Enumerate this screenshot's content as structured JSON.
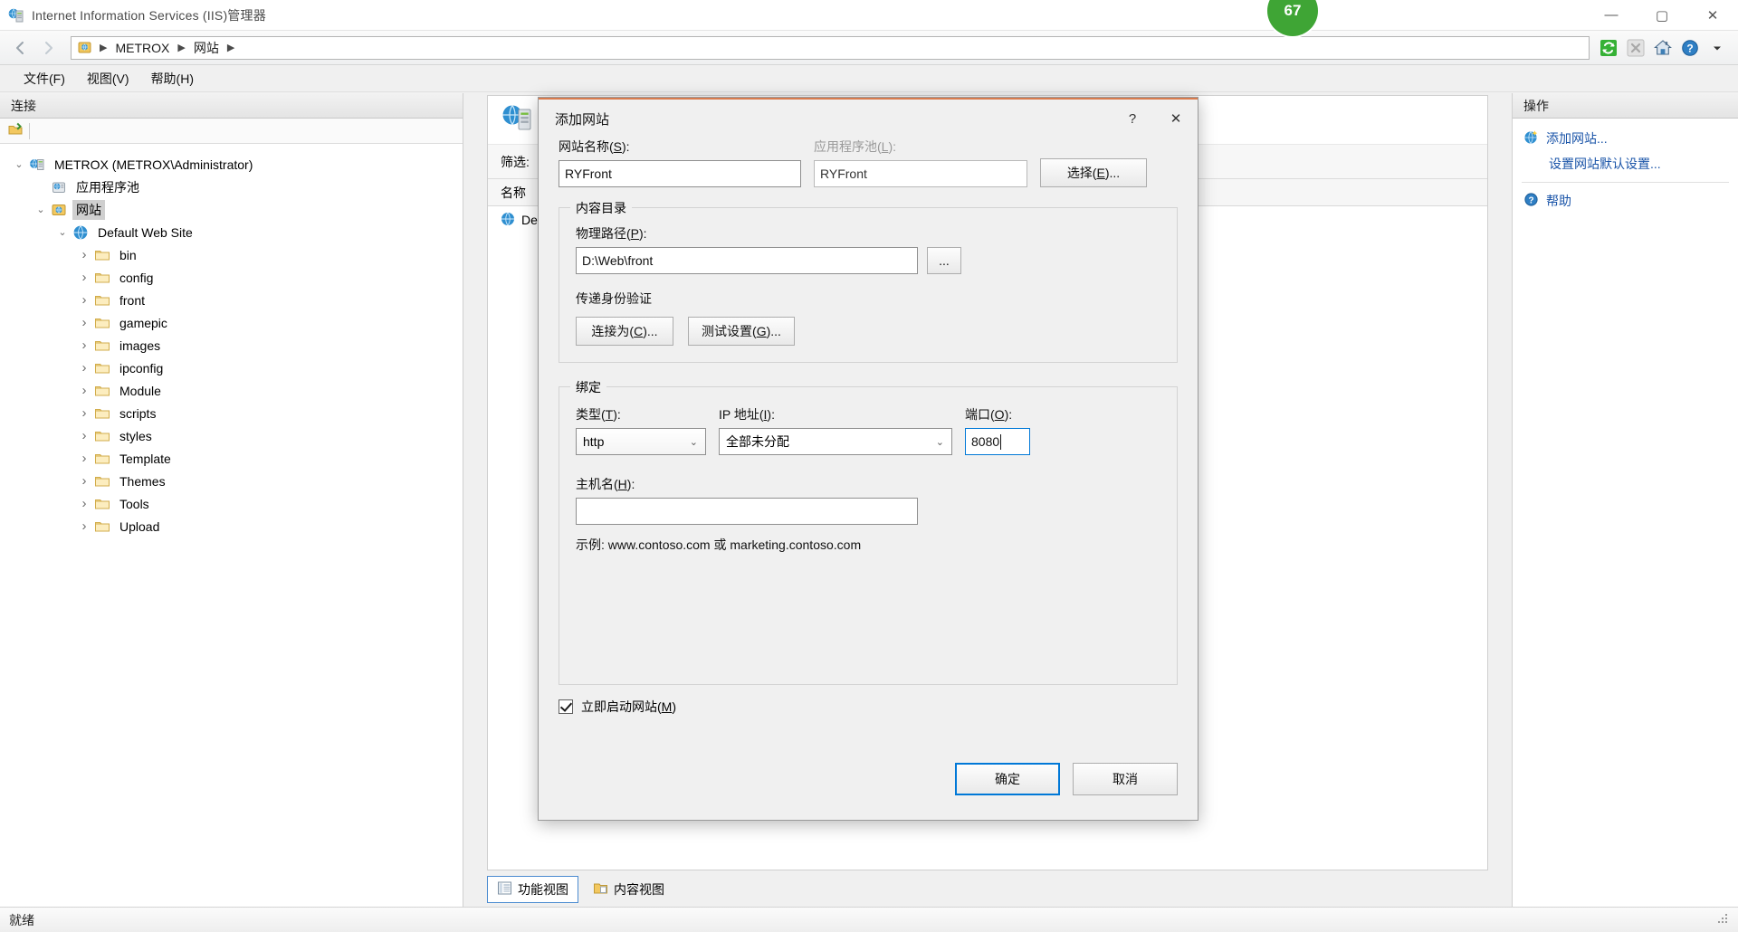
{
  "window": {
    "title": "Internet Information Services (IIS)管理器",
    "app_icon": "iis-icon",
    "badge": "67",
    "controls": {
      "minimize": "—",
      "maximize": "▢",
      "close": "✕"
    }
  },
  "addressbar": {
    "back_icon": "arrow-left-icon",
    "forward_icon": "arrow-right-icon",
    "root_icon": "server-icon",
    "crumbs": [
      "METROX",
      "网站"
    ],
    "separator": "▶",
    "tools": [
      "refresh-icon",
      "stop-icon",
      "home-icon",
      "help-icon",
      "dropdown-arrow-icon"
    ]
  },
  "menubar": {
    "items": [
      "文件(F)",
      "视图(V)",
      "帮助(H)"
    ]
  },
  "left_panel": {
    "header": "连接",
    "toolbar_icon": "connect-to-server-icon",
    "tree": [
      {
        "label": "METROX (METROX\\Administrator)",
        "icon": "server-icon",
        "expander": "v",
        "depth": 0,
        "selected": false
      },
      {
        "label": "应用程序池",
        "icon": "app-pool-icon",
        "expander": "",
        "depth": 1,
        "selected": false
      },
      {
        "label": "网站",
        "icon": "sites-folder-icon",
        "expander": "v",
        "depth": 1,
        "selected": true
      },
      {
        "label": "Default Web Site",
        "icon": "globe-icon",
        "expander": "v",
        "depth": 2,
        "selected": false
      },
      {
        "label": "bin",
        "icon": "folder-icon",
        "expander": ">",
        "depth": 3,
        "selected": false
      },
      {
        "label": "config",
        "icon": "folder-icon",
        "expander": ">",
        "depth": 3,
        "selected": false
      },
      {
        "label": "front",
        "icon": "folder-icon",
        "expander": ">",
        "depth": 3,
        "selected": false
      },
      {
        "label": "gamepic",
        "icon": "folder-icon",
        "expander": ">",
        "depth": 3,
        "selected": false
      },
      {
        "label": "images",
        "icon": "folder-icon",
        "expander": ">",
        "depth": 3,
        "selected": false
      },
      {
        "label": "ipconfig",
        "icon": "folder-icon",
        "expander": ">",
        "depth": 3,
        "selected": false
      },
      {
        "label": "Module",
        "icon": "folder-icon",
        "expander": ">",
        "depth": 3,
        "selected": false
      },
      {
        "label": "scripts",
        "icon": "folder-icon",
        "expander": ">",
        "depth": 3,
        "selected": false
      },
      {
        "label": "styles",
        "icon": "folder-icon",
        "expander": ">",
        "depth": 3,
        "selected": false
      },
      {
        "label": "Template",
        "icon": "folder-icon",
        "expander": ">",
        "depth": 3,
        "selected": false
      },
      {
        "label": "Themes",
        "icon": "folder-icon",
        "expander": ">",
        "depth": 3,
        "selected": false
      },
      {
        "label": "Tools",
        "icon": "folder-icon",
        "expander": ">",
        "depth": 3,
        "selected": false
      },
      {
        "label": "Upload",
        "icon": "folder-icon",
        "expander": ">",
        "depth": 3,
        "selected": false
      }
    ]
  },
  "center_panel": {
    "page_icon": "sites-page-icon",
    "filter_label": "筛选:",
    "grid_header": "名称",
    "rows": [
      {
        "name": "Defa",
        "icon": "globe-icon"
      }
    ],
    "tabs": [
      {
        "label": "功能视图",
        "icon": "features-view-icon",
        "active": true
      },
      {
        "label": "内容视图",
        "icon": "content-view-icon",
        "active": false
      }
    ]
  },
  "right_panel": {
    "header": "操作",
    "actions": [
      {
        "label": "添加网站...",
        "icon": "add-site-icon"
      },
      {
        "label": "设置网站默认设置...",
        "icon": ""
      },
      {
        "label": "帮助",
        "icon": "help-icon"
      }
    ]
  },
  "statusbar": {
    "text": "就绪",
    "grip_icon": "resize-grip-icon"
  },
  "dialog": {
    "title": "添加网站",
    "help_btn": "?",
    "close_btn": "✕",
    "site_name_label": "网站名称(S):",
    "site_name_accesskey": "S",
    "site_name_value": "RYFront",
    "app_pool_label": "应用程序池(L):",
    "app_pool_accesskey": "L",
    "app_pool_value": "RYFront",
    "select_button": "选择(E)...",
    "content_dir_group": "内容目录",
    "physical_path_label": "物理路径(P):",
    "physical_path_accesskey": "P",
    "physical_path_value": "D:\\Web\\front",
    "browse_button": "...",
    "passthrough_label": "传递身份验证",
    "connect_as_button": "连接为(C)...",
    "test_settings_button": "测试设置(G)...",
    "binding_group": "绑定",
    "type_label": "类型(T):",
    "type_accesskey": "T",
    "type_value": "http",
    "ip_label": "IP 地址(I):",
    "ip_accesskey": "I",
    "ip_value": "全部未分配",
    "port_label": "端口(O):",
    "port_accesskey": "O",
    "port_value": "8080",
    "hostname_label": "主机名(H):",
    "hostname_accesskey": "H",
    "hostname_value": "",
    "example_text": "示例: www.contoso.com 或 marketing.contoso.com",
    "start_now_label": "立即启动网站(M)",
    "start_now_accesskey": "M",
    "start_now_checked": true,
    "ok_button": "确定",
    "cancel_button": "取消"
  }
}
